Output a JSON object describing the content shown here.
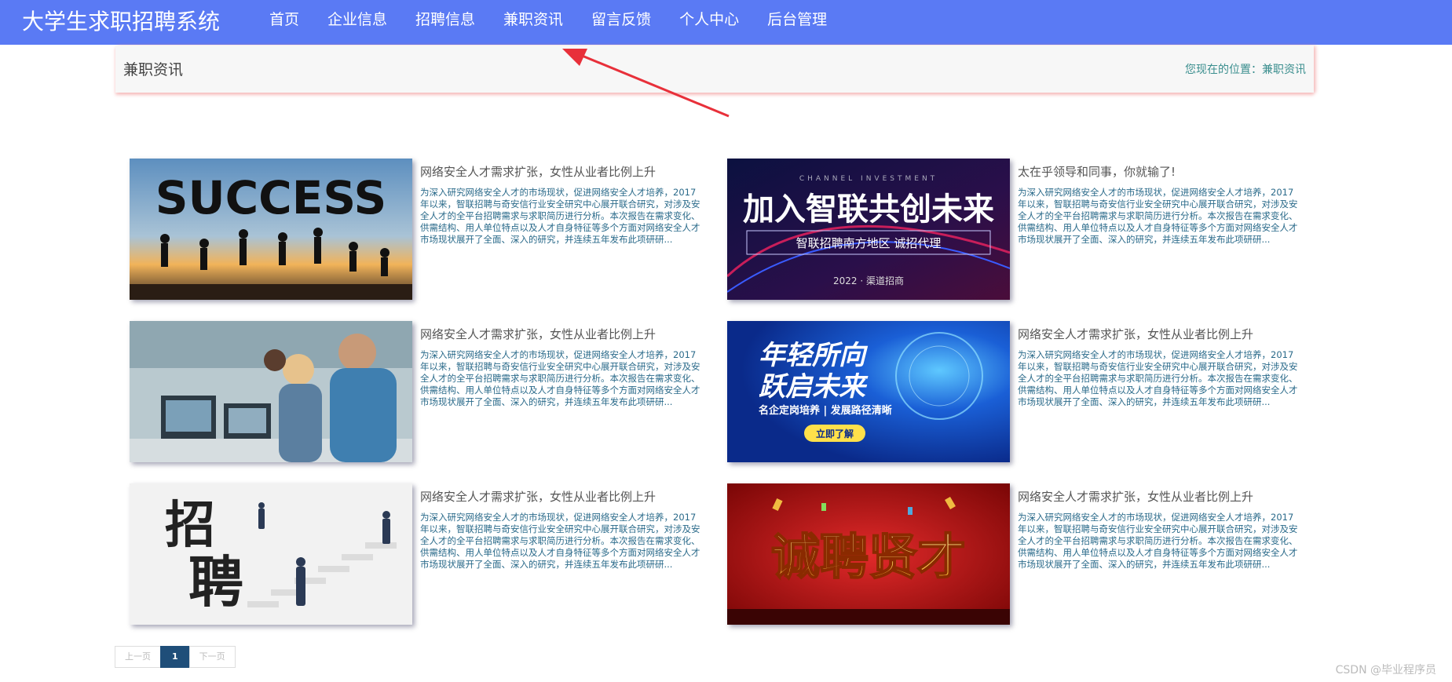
{
  "header": {
    "brand": "大学生求职招聘系统",
    "menu": [
      {
        "label": "首页"
      },
      {
        "label": "企业信息"
      },
      {
        "label": "招聘信息"
      },
      {
        "label": "兼职资讯"
      },
      {
        "label": "留言反馈"
      },
      {
        "label": "个人中心"
      },
      {
        "label": "后台管理"
      }
    ],
    "active_index": 3,
    "bg_color": "#5a7af4"
  },
  "breadcrumb": {
    "title": "兼职资讯",
    "location_text": "您现在的位置：兼职资讯"
  },
  "articles": [
    {
      "title": "网络安全人才需求扩张，女性从业者比例上升",
      "desc": "为深入研究网络安全人才的市场现状，促进网络安全人才培养，2017年以来，智联招聘与奇安信行业安全研究中心展开联合研究，对涉及安全人才的全平台招聘需求与求职简历进行分析。本次报告在需求变化、供需结构、用人单位特点以及人才自身特征等多个方面对网络安全人才市场现状展开了全面、深入的研究，并连续五年发布此项研研...",
      "image_text": "SUCCESS"
    },
    {
      "title": "太在乎领导和同事，你就输了!",
      "desc": "为深入研究网络安全人才的市场现状，促进网络安全人才培养，2017年以来，智联招聘与奇安信行业安全研究中心展开联合研究，对涉及安全人才的全平台招聘需求与求职简历进行分析。本次报告在需求变化、供需结构、用人单位特点以及人才自身特征等多个方面对网络安全人才市场现状展开了全面、深入的研究，并连续五年发布此项研研...",
      "image_top": "CHANNEL INVESTMENT",
      "image_text": "加入智联共创未来",
      "image_sub": "智联招聘南方地区 诚招代理",
      "image_year": "2022 · 渠道招商"
    },
    {
      "title": "网络安全人才需求扩张，女性从业者比例上升",
      "desc": "为深入研究网络安全人才的市场现状，促进网络安全人才培养，2017年以来，智联招聘与奇安信行业安全研究中心展开联合研究，对涉及安全人才的全平台招聘需求与求职简历进行分析。本次报告在需求变化、供需结构、用人单位特点以及人才自身特征等多个方面对网络安全人才市场现状展开了全面、深入的研究，并连续五年发布此项研研..."
    },
    {
      "title": "网络安全人才需求扩张，女性从业者比例上升",
      "desc": "为深入研究网络安全人才的市场现状，促进网络安全人才培养，2017年以来，智联招聘与奇安信行业安全研究中心展开联合研究，对涉及安全人才的全平台招聘需求与求职简历进行分析。本次报告在需求变化、供需结构、用人单位特点以及人才自身特征等多个方面对网络安全人才市场现状展开了全面、深入的研究，并连续五年发布此项研研...",
      "image_line1": "年轻所向",
      "image_line2": "跃启未来",
      "image_sub": "名企定岗培养 | 发展路径清晰",
      "image_btn": "立即了解"
    },
    {
      "title": "网络安全人才需求扩张，女性从业者比例上升",
      "desc": "为深入研究网络安全人才的市场现状，促进网络安全人才培养，2017年以来，智联招聘与奇安信行业安全研究中心展开联合研究，对涉及安全人才的全平台招聘需求与求职简历进行分析。本次报告在需求变化、供需结构、用人单位特点以及人才自身特征等多个方面对网络安全人才市场现状展开了全面、深入的研究，并连续五年发布此项研研...",
      "image_char1": "招",
      "image_char2": "聘"
    },
    {
      "title": "网络安全人才需求扩张，女性从业者比例上升",
      "desc": "为深入研究网络安全人才的市场现状，促进网络安全人才培养，2017年以来，智联招聘与奇安信行业安全研究中心展开联合研究，对涉及安全人才的全平台招聘需求与求职简历进行分析。本次报告在需求变化、供需结构、用人单位特点以及人才自身特征等多个方面对网络安全人才市场现状展开了全面、深入的研究，并连续五年发布此项研研...",
      "image_text": "诚聘贤才"
    }
  ],
  "pagination": {
    "prev": "上一页",
    "current": "1",
    "next": "下一页"
  },
  "watermark": "CSDN @毕业程序员"
}
